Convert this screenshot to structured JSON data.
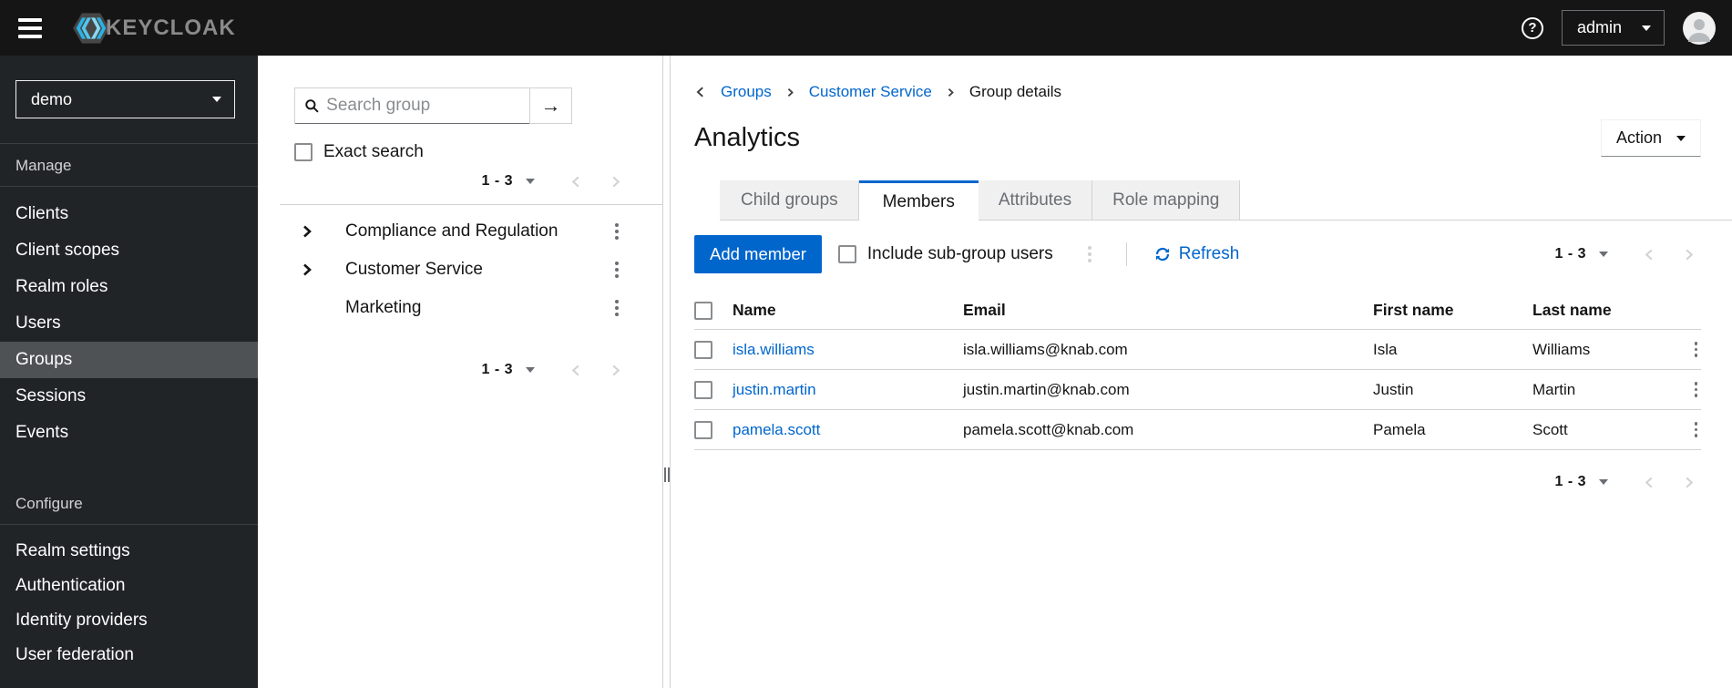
{
  "header": {
    "brand": "KEYCLOAK",
    "username": "admin"
  },
  "sidebar": {
    "realm": "demo",
    "sections": [
      {
        "label": "Manage",
        "items": [
          "Clients",
          "Client scopes",
          "Realm roles",
          "Users",
          "Groups",
          "Sessions",
          "Events"
        ]
      },
      {
        "label": "Configure",
        "items": [
          "Realm settings",
          "Authentication",
          "Identity providers",
          "User federation"
        ]
      }
    ],
    "active_item": "Groups"
  },
  "groups_panel": {
    "search_placeholder": "Search group",
    "exact_search_label": "Exact search",
    "top_pagination": "1 - 3",
    "bottom_pagination": "1 - 3",
    "tree": [
      {
        "label": "Compliance and Regulation"
      },
      {
        "label": "Customer Service"
      },
      {
        "label": "Marketing"
      }
    ]
  },
  "main": {
    "breadcrumb": {
      "items": [
        "Groups",
        "Customer Service",
        "Group details"
      ]
    },
    "title": "Analytics",
    "action_label": "Action",
    "tabs": [
      "Child groups",
      "Members",
      "Attributes",
      "Role mapping"
    ],
    "active_tab": "Members",
    "toolbar": {
      "add_member_label": "Add member",
      "include_subgroups_label": "Include sub-group users",
      "refresh_label": "Refresh",
      "pagination": "1 - 3"
    },
    "table": {
      "headers": {
        "name": "Name",
        "email": "Email",
        "first": "First name",
        "last": "Last name"
      },
      "rows": [
        {
          "name": "isla.williams",
          "email": "isla.williams@knab.com",
          "first": "Isla",
          "last": "Williams"
        },
        {
          "name": "justin.martin",
          "email": "justin.martin@knab.com",
          "first": "Justin",
          "last": "Martin"
        },
        {
          "name": "pamela.scott",
          "email": "pamela.scott@knab.com",
          "first": "Pamela",
          "last": "Scott"
        }
      ]
    },
    "bottom_pagination": "1 - 3"
  },
  "colors": {
    "accent": "#0066cc",
    "header_bg": "#151515",
    "sidebar_bg": "#212427",
    "active_nav_bg": "#4f5255",
    "border": "#d2d2d2"
  }
}
